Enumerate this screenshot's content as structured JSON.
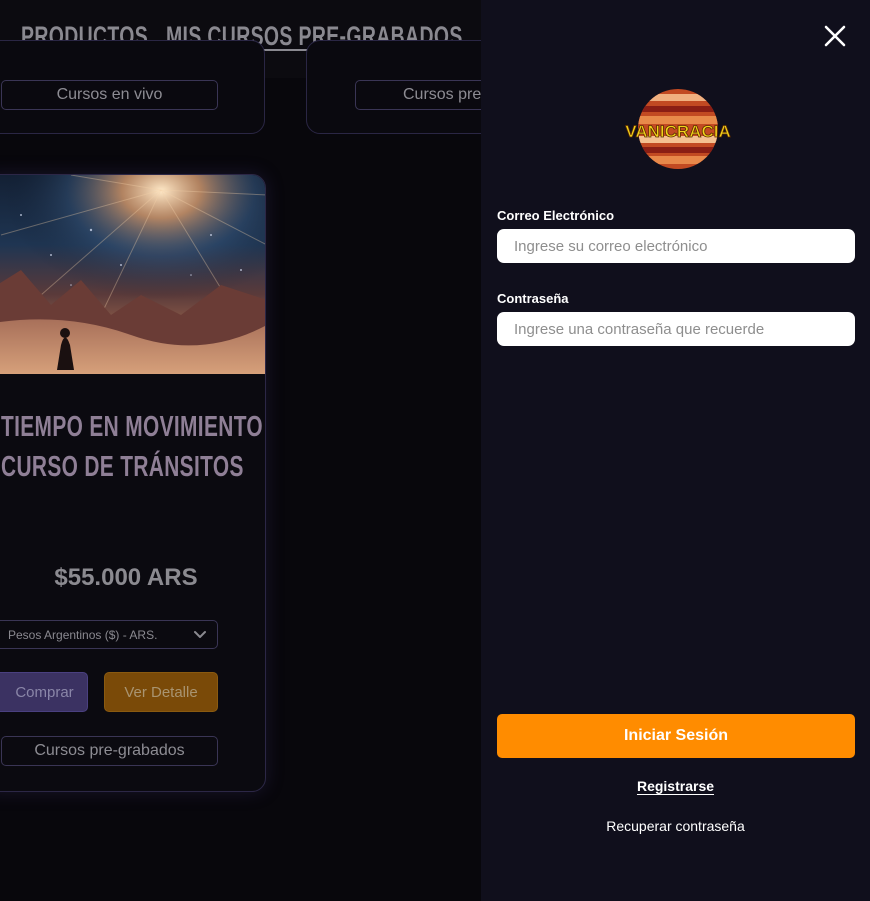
{
  "nav": {
    "products_label": "PRODUCTOS",
    "my_courses_label": "MIS CURSOS PRE-GRABADOS"
  },
  "top_cards": [
    {
      "tag": "Cursos en vivo"
    },
    {
      "tag": "Cursos pre-"
    }
  ],
  "course_card": {
    "title_line1": "TIEMPO EN MOVIMIENTO:",
    "title_line2": "CURSO DE TRÁNSITOS",
    "price": "$55.000 ARS",
    "currency_selected": "Pesos Argentinos ($) - ARS.",
    "buy_label": "Comprar",
    "detail_label": "Ver Detalle",
    "tag": "Cursos pre-grabados"
  },
  "login": {
    "logo_text": "VANICRACIA",
    "email_label": "Correo Electrónico",
    "email_placeholder": "Ingrese su correo electrónico",
    "password_label": "Contraseña",
    "password_placeholder": "Ingrese una contraseña que recuerde",
    "submit_label": "Iniciar Sesión",
    "register_label": "Registrarse",
    "recover_label": "Recuperar contraseña"
  },
  "colors": {
    "accent": "#ff8c00",
    "drawer_bg": "#100f1c",
    "page_bg": "#08070c",
    "buy_button": "#3b3262",
    "detail_button": "#7a4a08"
  },
  "icons": {
    "close": "close-icon",
    "select_chevron": "chevron-down-icon"
  }
}
